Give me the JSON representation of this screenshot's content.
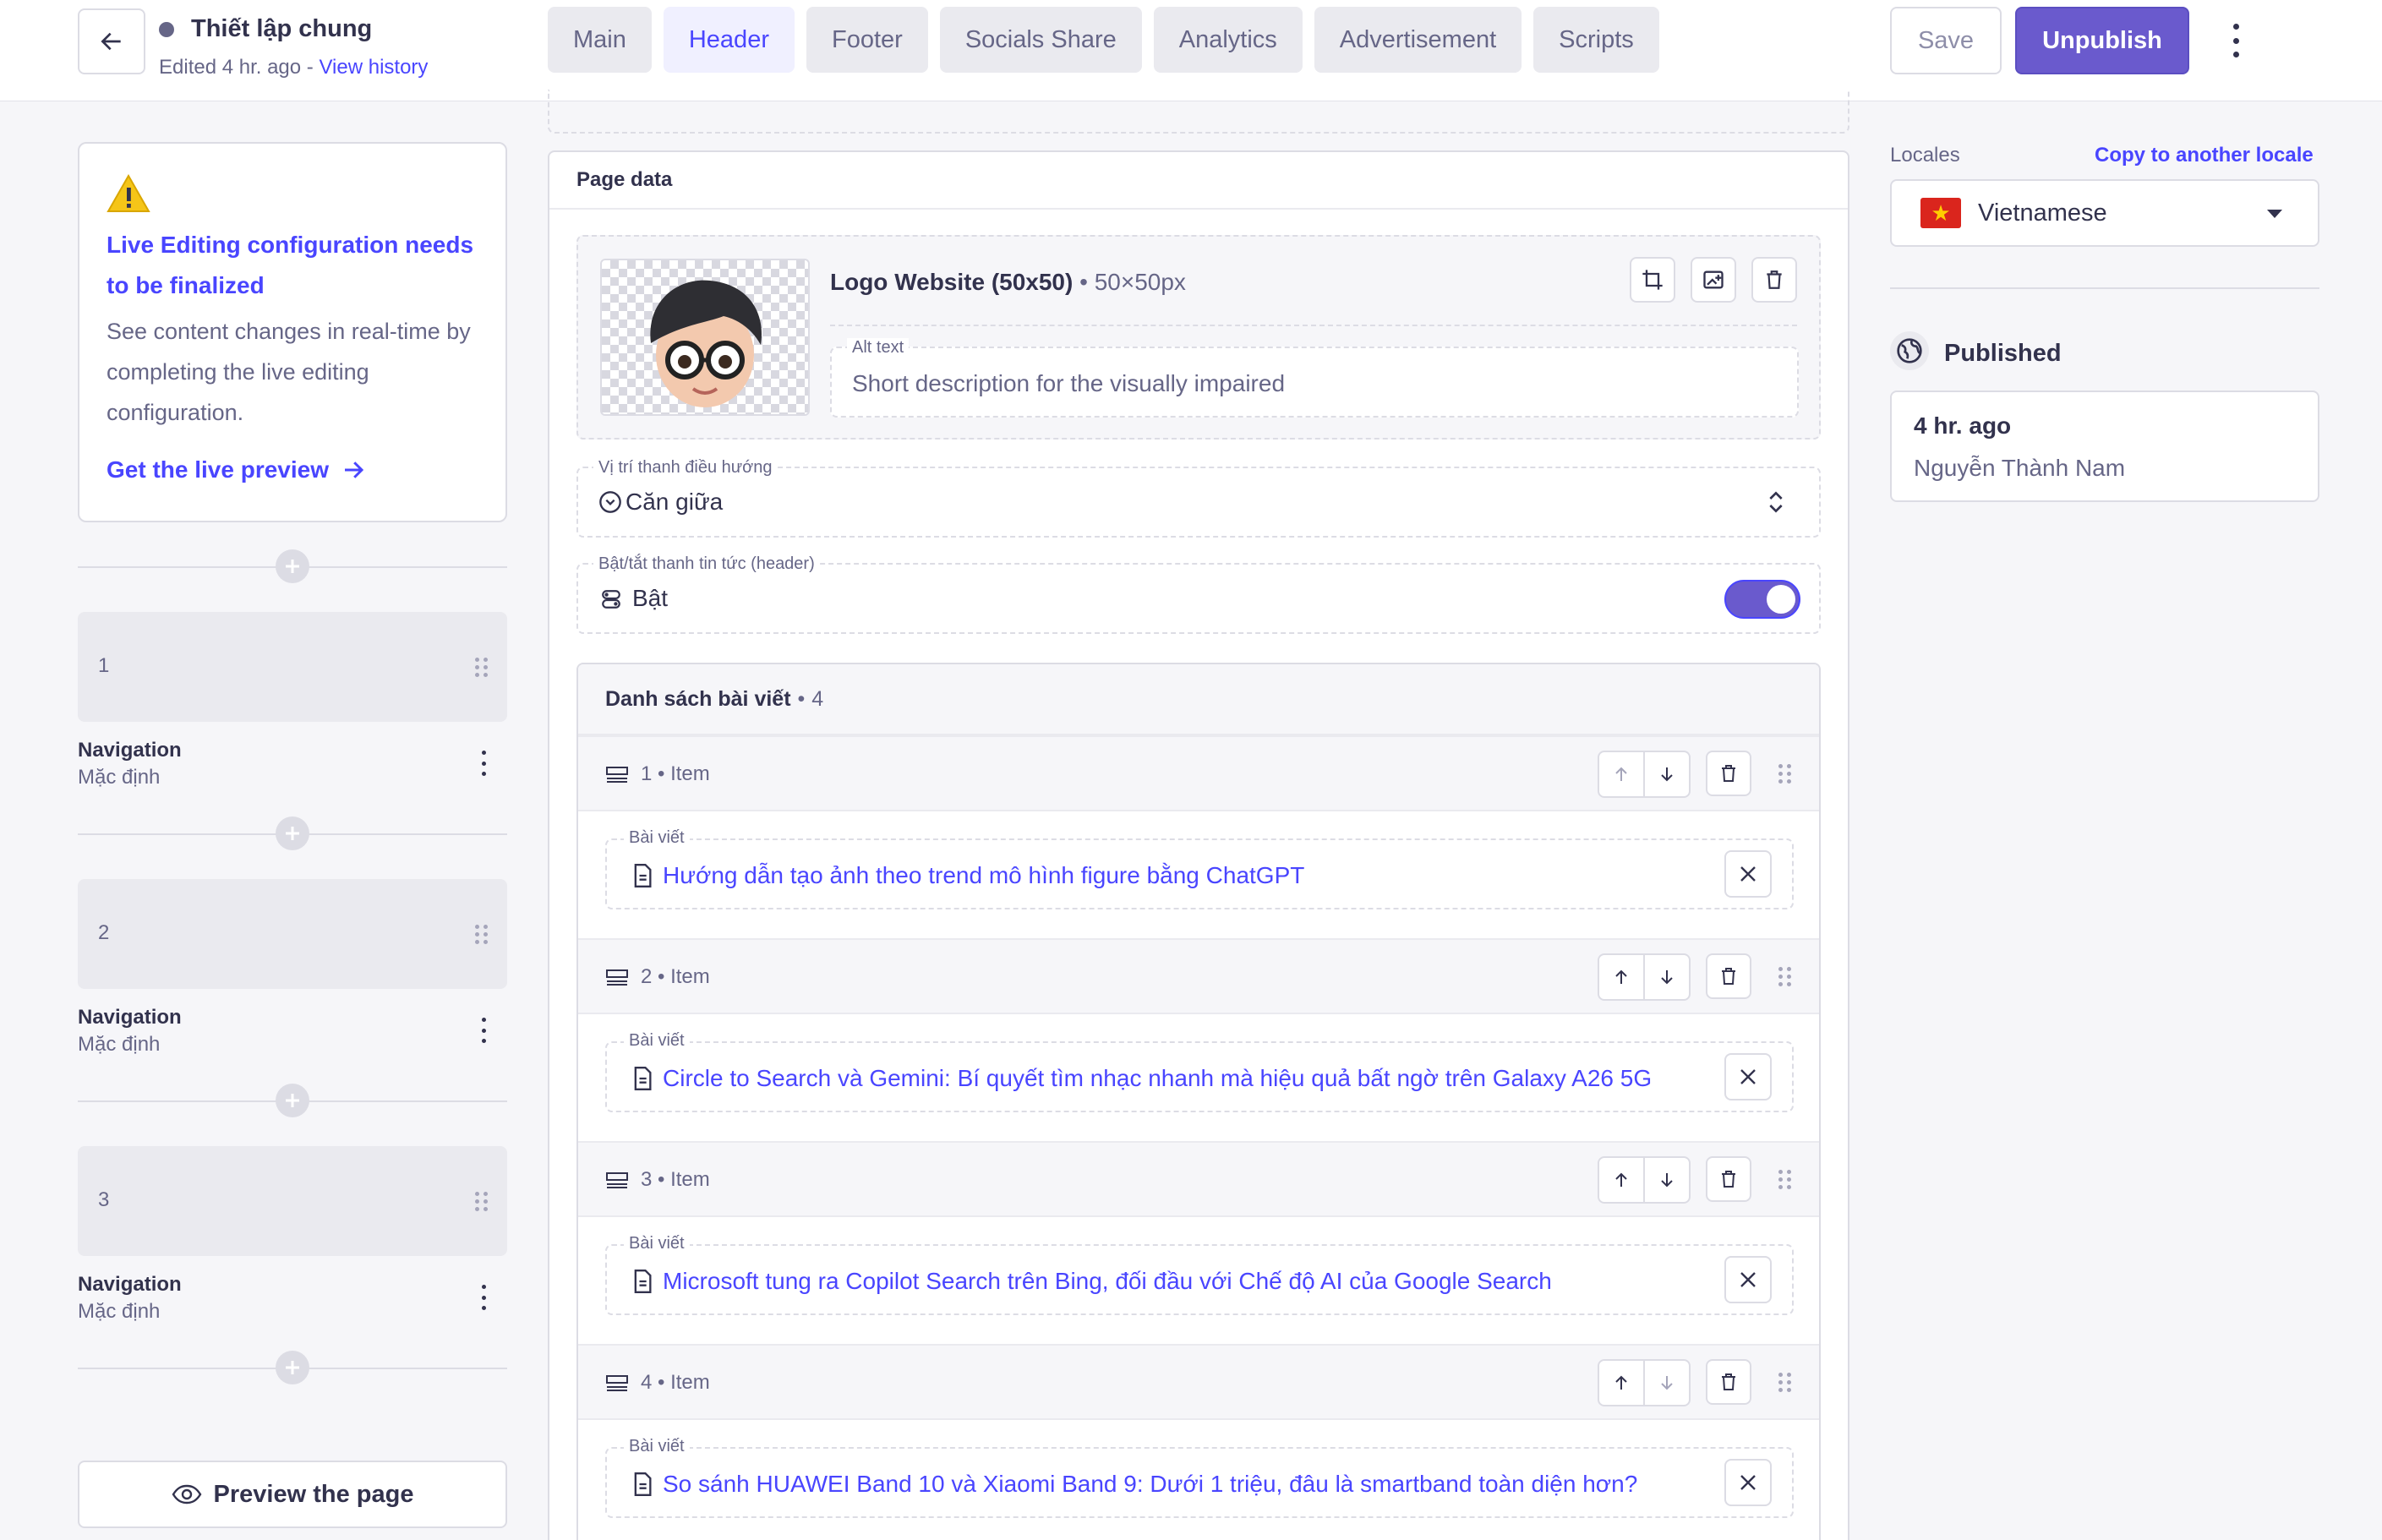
{
  "header": {
    "title": "Thiết lập chung",
    "edited_prefix": "Edited 4 hr. ago - ",
    "view_history": "View history",
    "tabs": [
      "Main",
      "Header",
      "Footer",
      "Socials Share",
      "Analytics",
      "Advertisement",
      "Scripts"
    ],
    "active_tab": "Header",
    "save": "Save",
    "unpublish": "Unpublish"
  },
  "left": {
    "warning_title": "Live Editing configuration needs to be finalized",
    "warning_text": "See content changes in real-time by completing the live editing configuration.",
    "warning_link": "Get the live preview",
    "nav_items": [
      {
        "num": "1",
        "label": "Navigation",
        "sub": "Mặc định"
      },
      {
        "num": "2",
        "label": "Navigation",
        "sub": "Mặc định"
      },
      {
        "num": "3",
        "label": "Navigation",
        "sub": "Mặc định"
      }
    ],
    "preview": "Preview the page"
  },
  "main": {
    "panel_title": "Page data",
    "logo": {
      "name": "Logo Website (50x50)",
      "size": "50×50px",
      "alt_label": "Alt text",
      "alt_placeholder": "Short description for the visually impaired"
    },
    "nav_position": {
      "label": "Vị trí thanh điều hướng",
      "value": "Căn giữa"
    },
    "news_toggle": {
      "label": "Bật/tắt thanh tin tức (header)",
      "value": "Bật",
      "on": true
    },
    "list": {
      "title": "Danh sách bài viết",
      "count": "4",
      "items": [
        {
          "label": "1 • Item",
          "field_label": "Bài viết",
          "post": "Hướng dẫn tạo ảnh theo trend mô hình figure bằng ChatGPT"
        },
        {
          "label": "2 • Item",
          "field_label": "Bài viết",
          "post": "Circle to Search và Gemini: Bí quyết tìm nhạc nhanh mà hiệu quả bất ngờ trên Galaxy A26 5G"
        },
        {
          "label": "3 • Item",
          "field_label": "Bài viết",
          "post": "Microsoft tung ra Copilot Search trên Bing, đối đầu với Chế độ AI của Google Search"
        },
        {
          "label": "4 • Item",
          "field_label": "Bài viết",
          "post": "So sánh HUAWEI Band 10 và Xiaomi Band 9: Dưới 1 triệu, đâu là smartband toàn diện hơn?"
        }
      ]
    }
  },
  "right": {
    "locales_label": "Locales",
    "copy_locale": "Copy to another locale",
    "locale": "Vietnamese",
    "status": "Published",
    "time": "4 hr. ago",
    "user": "Nguyễn Thành Nam"
  },
  "colors": {
    "primary": "#4945ff",
    "button": "#6a5acd",
    "border": "#dcdce4",
    "bg": "#f6f6f9"
  }
}
